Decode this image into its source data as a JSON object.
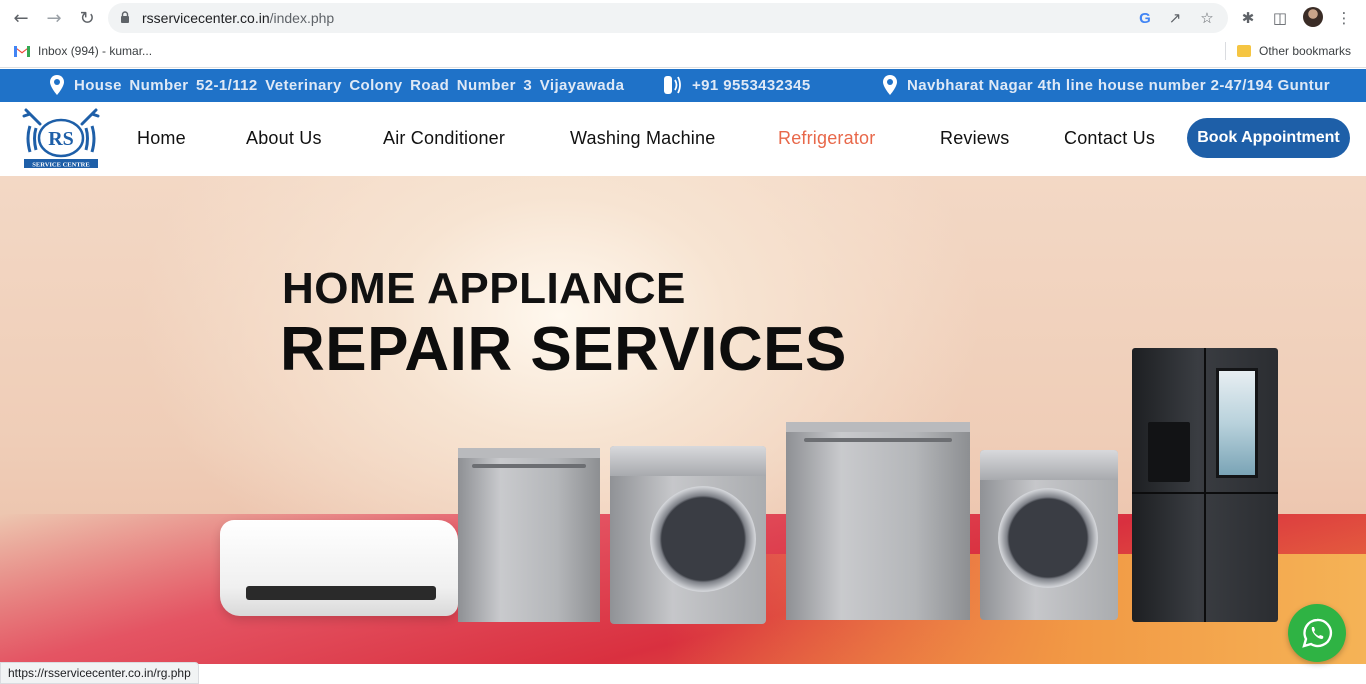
{
  "browser": {
    "url_domain": "rsservicecenter.co.in",
    "url_path": "/index.php",
    "bookmarks": [
      {
        "label": "Inbox (994) - kumar..."
      },
      {
        "label": "Other bookmarks"
      }
    ],
    "status_url": "https://rsservicecenter.co.in/rg.php"
  },
  "topbar": {
    "address1": "House Number 52-1/112 Veterinary Colony Road Number 3 Vijayawada",
    "phone": "+91 9553432345",
    "address2": "Navbharat Nagar 4th line house number 2-47/194 Guntur"
  },
  "nav": {
    "items": [
      {
        "label": "Home"
      },
      {
        "label": "About Us"
      },
      {
        "label": "Air Conditioner"
      },
      {
        "label": "Washing Machine"
      },
      {
        "label": "Refrigerator"
      },
      {
        "label": "Reviews"
      },
      {
        "label": "Contact Us"
      }
    ],
    "active": "Refrigerator",
    "cta": "Book Appointment"
  },
  "logo": {
    "text": "RS",
    "subtext": "SERVICE CENTRE"
  },
  "hero": {
    "line1": "HOME APPLIANCE",
    "line2": "REPAIR SERVICES"
  },
  "colors": {
    "topbar": "#1f72c8",
    "cta": "#1e5fa8",
    "active_nav": "#e8684a",
    "whatsapp": "#2fb344"
  }
}
